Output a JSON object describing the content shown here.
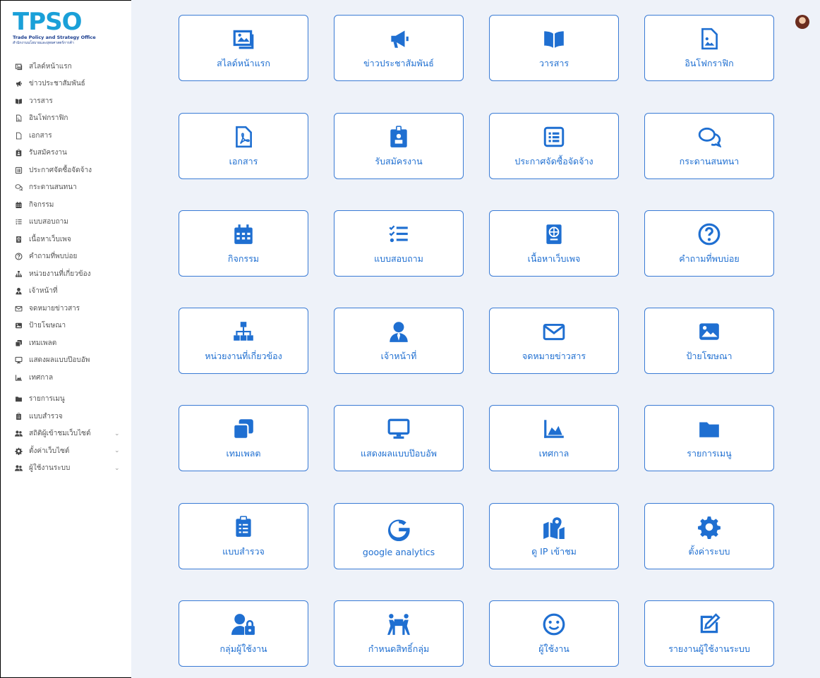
{
  "logo": {
    "brand": "TPSO",
    "sub1": "Trade Policy and Strategy Office",
    "sub2": "สำนักงานนโยบายและยุทธศาสตร์การค้า"
  },
  "sidebar": {
    "items": [
      {
        "label": "สไลด์หน้าแรก",
        "icon": "image-icon"
      },
      {
        "label": "ข่าวประชาสัมพันธ์",
        "icon": "megaphone-icon"
      },
      {
        "label": "วารสาร",
        "icon": "book-icon"
      },
      {
        "label": "อินโฟกราฟิก",
        "icon": "file-image-icon"
      },
      {
        "label": "เอกสาร",
        "icon": "file-icon"
      },
      {
        "label": "รับสมัครงาน",
        "icon": "id-badge-icon"
      },
      {
        "label": "ประกาศจัดซื้อจัดจ้าง",
        "icon": "list-icon"
      },
      {
        "label": "กระดานสนทนา",
        "icon": "comments-icon"
      },
      {
        "label": "กิจกรรม",
        "icon": "calendar-icon"
      },
      {
        "label": "แบบสอบถาม",
        "icon": "tasks-icon"
      },
      {
        "label": "เนื้อหาเว็บเพจ",
        "icon": "passport-icon"
      },
      {
        "label": "คำถามที่พบบ่อย",
        "icon": "question-icon"
      },
      {
        "label": "หน่วยงานที่เกี่ยวข้อง",
        "icon": "sitemap-icon"
      },
      {
        "label": "เจ้าหน้าที่",
        "icon": "user-tie-icon"
      },
      {
        "label": "จดหมายข่าวสาร",
        "icon": "envelope-icon"
      },
      {
        "label": "ป้ายโฆษณา",
        "icon": "photo-icon"
      },
      {
        "label": "เทมเพลต",
        "icon": "clone-icon"
      },
      {
        "label": "แสดงผลแบบป๊อบอัพ",
        "icon": "desktop-icon"
      },
      {
        "label": "เทศกาล",
        "icon": "chart-area-icon"
      }
    ],
    "items2": [
      {
        "label": "รายการเมนู",
        "icon": "folder-icon",
        "caret": ""
      },
      {
        "label": "แบบสำรวจ",
        "icon": "clipboard-icon",
        "caret": ""
      },
      {
        "label": "สถิติผู้เข้าชมเว็บไซต์",
        "icon": "users-icon",
        "caret": "⌄"
      },
      {
        "label": "ตั้งค่าเว็บไซต์",
        "icon": "cog-icon",
        "caret": "⌄"
      },
      {
        "label": "ผู้ใช้งานระบบ",
        "icon": "users-icon",
        "caret": "⌄"
      }
    ]
  },
  "tiles": [
    {
      "label": "สไลด์หน้าแรก",
      "icon": "image-icon"
    },
    {
      "label": "ข่าวประชาสัมพันธ์",
      "icon": "megaphone-icon"
    },
    {
      "label": "วารสาร",
      "icon": "book-icon"
    },
    {
      "label": "อินโฟกราฟิก",
      "icon": "file-image-icon"
    },
    {
      "label": "เอกสาร",
      "icon": "file-pdf-icon"
    },
    {
      "label": "รับสมัครงาน",
      "icon": "id-badge-icon"
    },
    {
      "label": "ประกาศจัดซื้อจัดจ้าง",
      "icon": "list-icon"
    },
    {
      "label": "กระดานสนทนา",
      "icon": "comments-icon"
    },
    {
      "label": "กิจกรรม",
      "icon": "calendar-icon"
    },
    {
      "label": "แบบสอบถาม",
      "icon": "tasks-icon"
    },
    {
      "label": "เนื้อหาเว็บเพจ",
      "icon": "passport-icon"
    },
    {
      "label": "คำถามที่พบบ่อย",
      "icon": "question-icon"
    },
    {
      "label": "หน่วยงานที่เกี่ยวข้อง",
      "icon": "sitemap-icon"
    },
    {
      "label": "เจ้าหน้าที่",
      "icon": "user-tie-icon"
    },
    {
      "label": "จดหมายข่าวสาร",
      "icon": "envelope-icon"
    },
    {
      "label": "ป้ายโฆษณา",
      "icon": "photo-icon"
    },
    {
      "label": "เทมเพลต",
      "icon": "clone-icon"
    },
    {
      "label": "แสดงผลแบบป๊อบอัพ",
      "icon": "desktop-icon"
    },
    {
      "label": "เทศกาล",
      "icon": "chart-area-icon"
    },
    {
      "label": "รายการเมนู",
      "icon": "folder-icon"
    },
    {
      "label": "แบบสำรวจ",
      "icon": "clipboard-icon"
    },
    {
      "label": "google analytics",
      "icon": "google-icon"
    },
    {
      "label": "ดู IP เข้าชม",
      "icon": "map-marked-icon"
    },
    {
      "label": "ตั้งค่าระบบ",
      "icon": "cog-icon"
    },
    {
      "label": "กลุ่มผู้ใช้งาน",
      "icon": "user-lock-icon"
    },
    {
      "label": "กำหนดสิทธิ์กลุ่ม",
      "icon": "people-carry-icon"
    },
    {
      "label": "ผู้ใช้งาน",
      "icon": "smile-icon"
    },
    {
      "label": "รายงานผู้ใช้งานระบบ",
      "icon": "edit-icon"
    }
  ],
  "colors": {
    "accent": "#1f6fd1",
    "background": "#eef2f9"
  }
}
